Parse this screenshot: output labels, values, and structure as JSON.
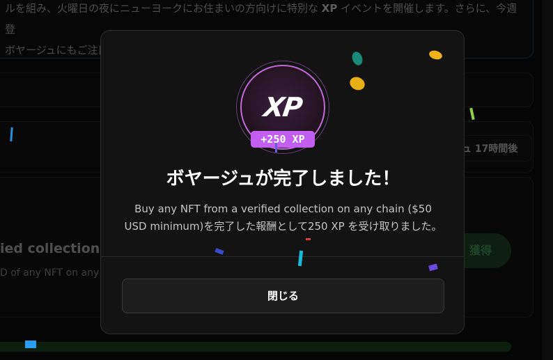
{
  "background": {
    "announcement_line1_pre": "ルを組み、火曜日の夜にニューヨークにお住まいの方向けに特別な ",
    "announcement_line1_bold": "XP",
    "announcement_line1_post": " イベントを開催します。さらに、今週登",
    "announcement_line2": "ボヤージュにもご注目ください。",
    "countdown": "ュ 17時間後",
    "task_title": "ied collection on any chain",
    "task_desc": "D of any NFT on any chain",
    "claim_button": "獲得"
  },
  "modal": {
    "badge_text": "XP",
    "xp_pill": "+250 XP",
    "title": "ボヤージュが完了しました！",
    "description": "Buy any NFT from a verified collection on any chain ($50 USD minimum)を完了した報酬として250 XP を受け取りました。",
    "close_button": "閉じる"
  },
  "colors": {
    "accent_purple": "#c25ef0",
    "success_green": "#1a3a1f",
    "announcement_border": "#1d3a66"
  }
}
